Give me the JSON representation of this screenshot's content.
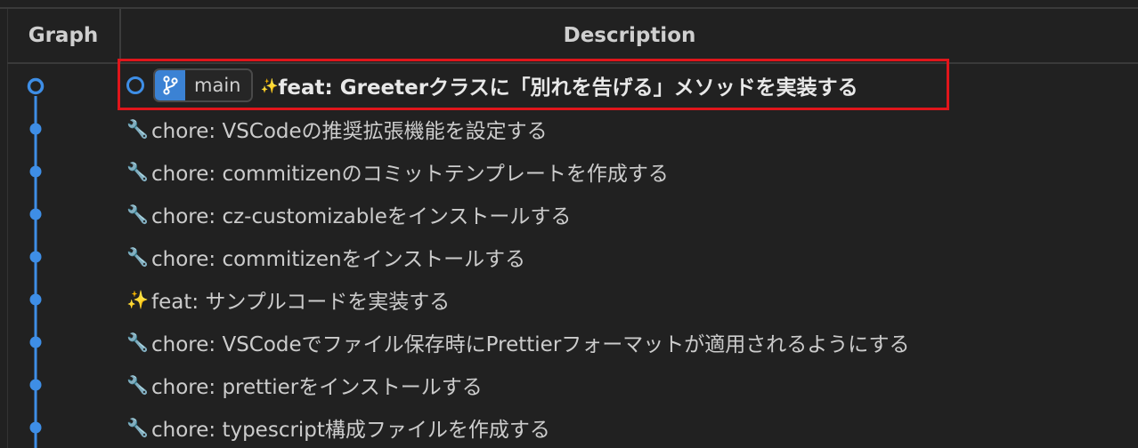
{
  "header": {
    "graph_label": "Graph",
    "description_label": "Description"
  },
  "colors": {
    "graph_line": "#3e8ee6",
    "selection_border": "#e0161b",
    "branch_badge": "#3b82d4"
  },
  "head_commit": {
    "branch": "main",
    "emoji": "✨",
    "message": "feat: Greeterクラスに「別れを告げる」メソッドを実装する",
    "icon": "git-branch-icon"
  },
  "commits": [
    {
      "emoji": "🔧",
      "icon": "wrench-icon",
      "message": "chore: VSCodeの推奨拡張機能を設定する"
    },
    {
      "emoji": "🔧",
      "icon": "wrench-icon",
      "message": "chore: commitizenのコミットテンプレートを作成する"
    },
    {
      "emoji": "🔧",
      "icon": "wrench-icon",
      "message": "chore: cz-customizableをインストールする"
    },
    {
      "emoji": "🔧",
      "icon": "wrench-icon",
      "message": "chore: commitizenをインストールする"
    },
    {
      "emoji": "✨",
      "icon": "sparkles-icon",
      "message": "feat: サンプルコードを実装する"
    },
    {
      "emoji": "🔧",
      "icon": "wrench-icon",
      "message": "chore: VSCodeでファイル保存時にPrettierフォーマットが適用されるようにする"
    },
    {
      "emoji": "🔧",
      "icon": "wrench-icon",
      "message": "chore: prettierをインストールする"
    },
    {
      "emoji": "🔧",
      "icon": "wrench-icon",
      "message": "chore: typescript構成ファイルを作成する"
    }
  ]
}
